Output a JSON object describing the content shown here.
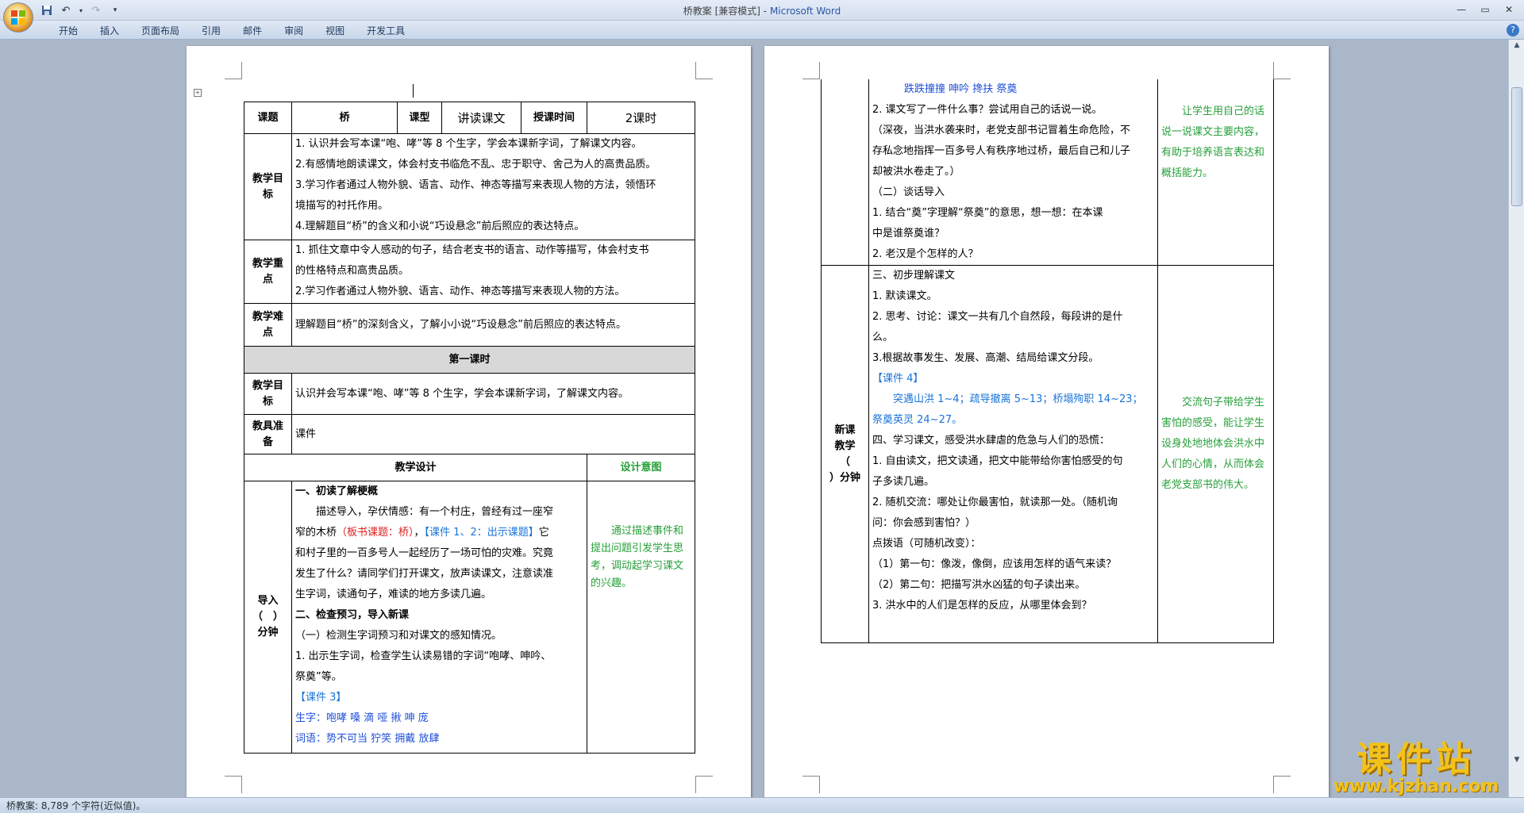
{
  "window": {
    "title_doc": "桥教案 [兼容模式]",
    "title_sep": " - ",
    "title_app": "Microsoft Word"
  },
  "ribbon": {
    "tabs": [
      "开始",
      "插入",
      "页面布局",
      "引用",
      "邮件",
      "审阅",
      "视图",
      "开发工具"
    ]
  },
  "status": {
    "text": "桥教案: 8,789 个字符(近似值)。"
  },
  "watermark": {
    "brand": "课件站",
    "url": "www.kjzhan.com"
  },
  "page1": {
    "row1": {
      "label_topic": "课题",
      "topic": "桥",
      "label_type": "课型",
      "type": "讲读课文",
      "label_time": "授课时间",
      "time": "2课时"
    },
    "goals_label": "教学目标",
    "goals": [
      "1. 认识并会写本课“咆、哮”等 8 个生字，学会本课新字词，了解课文内容。",
      "2.有感情地朗读课文，体会村支书临危不乱、忠于职守、舍己为人的高贵品质。",
      "3.学习作者通过人物外貌、语言、动作、神态等描写来表现人物的方法，领悟环",
      "境描写的衬托作用。",
      "4.理解题目“桥”的含义和小说“巧设悬念”前后照应的表达特点。"
    ],
    "focus_label": "教学重点",
    "focus": [
      "1.  抓住文章中令人感动的句子，结合老支书的语言、动作等描写，体会村支书",
      "的性格特点和高贵品质。",
      "2.学习作者通过人物外貌、语言、动作、神态等描写来表现人物的方法。"
    ],
    "difficulty_label": "教学难点",
    "difficulty": "理解题目“桥”的深刻含义，了解小小说“巧设悬念”前后照应的表达特点。",
    "lesson1_title": "第一课时",
    "l1_goal_label": "教学目标",
    "l1_goal": "认识并会写本课“咆、哮”等 8 个生字，学会本课新字词，了解课文内容。",
    "tools_label": "教具准备",
    "tools": "课件",
    "design_label": "教学设计",
    "intent_label": "设计意图",
    "intro_label_1": "导入",
    "intro_label_2": "（　）",
    "intro_label_3": "分钟",
    "design": {
      "h1": "一、初读了解梗概",
      "p1a": "描述导入，孕伏情感：有一个村庄，曾经有过一座窄",
      "p1b_pre": "窄的木桥",
      "p1b_red": "（板书课题：桥）",
      "p1b_sep": "，",
      "p1b_blue": "【课件 1、2：出示课题】",
      "p1b_post": "它",
      "p1c": "和村子里的一百多号人一起经历了一场可怕的灾难。究竟",
      "p1d": "发生了什么？请同学们打开课文，放声读课文，注意读准",
      "p1e": "生字词，读通句子，难读的地方多读几遍。",
      "h2": "二、检查预习，导入新课",
      "p2a": "（一）检测生字词预习和对课文的感知情况。",
      "p2b": " 1. 出示生字词，检查学生认读易错的字词“咆哮、呻吟、",
      "p2c": "祭奠”等。",
      "courseware3": "【课件 3】",
      "chars": "生字：咆哮  嗓   滴  哑  揪  呻  庞",
      "words": "词语：势不可当     狞笑    拥戴    放肆"
    },
    "intent1": "通过描述事件和提出问题引发学生思考，调动起学习课文的兴趣。"
  },
  "page2": {
    "top_words": "跌跌撞撞     呻吟    搀扶    祭奠",
    "t1": "2. 课文写了一件什么事？尝试用自己的话说一说。",
    "t2": "（深夜，当洪水袭来时，老党支部书记冒着生命危险，不",
    "t3": "存私念地指挥一百多号人有秩序地过桥，最后自己和儿子",
    "t4": "却被洪水卷走了。）",
    "t5": "（二）谈话导入",
    "t6": " 1. 结合“奠”字理解“祭奠”的意思，想一想：在本课",
    "t7": "中是谁祭奠谁？",
    "t8": " 2. 老汉是个怎样的人？",
    "intent_top": "让学生用自己的话说一说课文主要内容，有助于培养语言表达和概括能力。",
    "new_label_1": "新课",
    "new_label_2": "教学",
    "new_label_3": "（",
    "new_label_4": "）分钟",
    "b1": "三、初步理解课文",
    "b2": "1. 默读课文。",
    "b3": "2. 思考、讨论：课文一共有几个自然段，每段讲的是什",
    "b4": "么。",
    "b5": "3.根据故事发生、发展、高潮、结局给课文分段。",
    "b6": "【课件 4】",
    "b7": "突遇山洪 1~4；疏导撤离 5~13；桥塌殉职 14~23；",
    "b8": "祭奠英灵 24~27。",
    "b9": "四、学习课文，感受洪水肆虐的危急与人们的恐慌：",
    "b10": "1. 自由读文，把文读通，把文中能带给你害怕感受的句",
    "b11": "子多读几遍。",
    "b12": "2. 随机交流：哪处让你最害怕，就读那一处。（随机询",
    "b13": "问：你会感到害怕？）",
    "b14": "点拨语（可随机改变）：",
    "b15": "（1）第一句：像泼，像倒，应该用怎样的语气来读？",
    "b16": "（2）第二句：把描写洪水凶猛的句子读出来。",
    "b17": "3. 洪水中的人们是怎样的反应，从哪里体会到？",
    "intent_bottom": "交流句子带给学生害怕的感受，能让学生设身处地地体会洪水中人们的心情，从而体会老党支部书的伟大。"
  }
}
